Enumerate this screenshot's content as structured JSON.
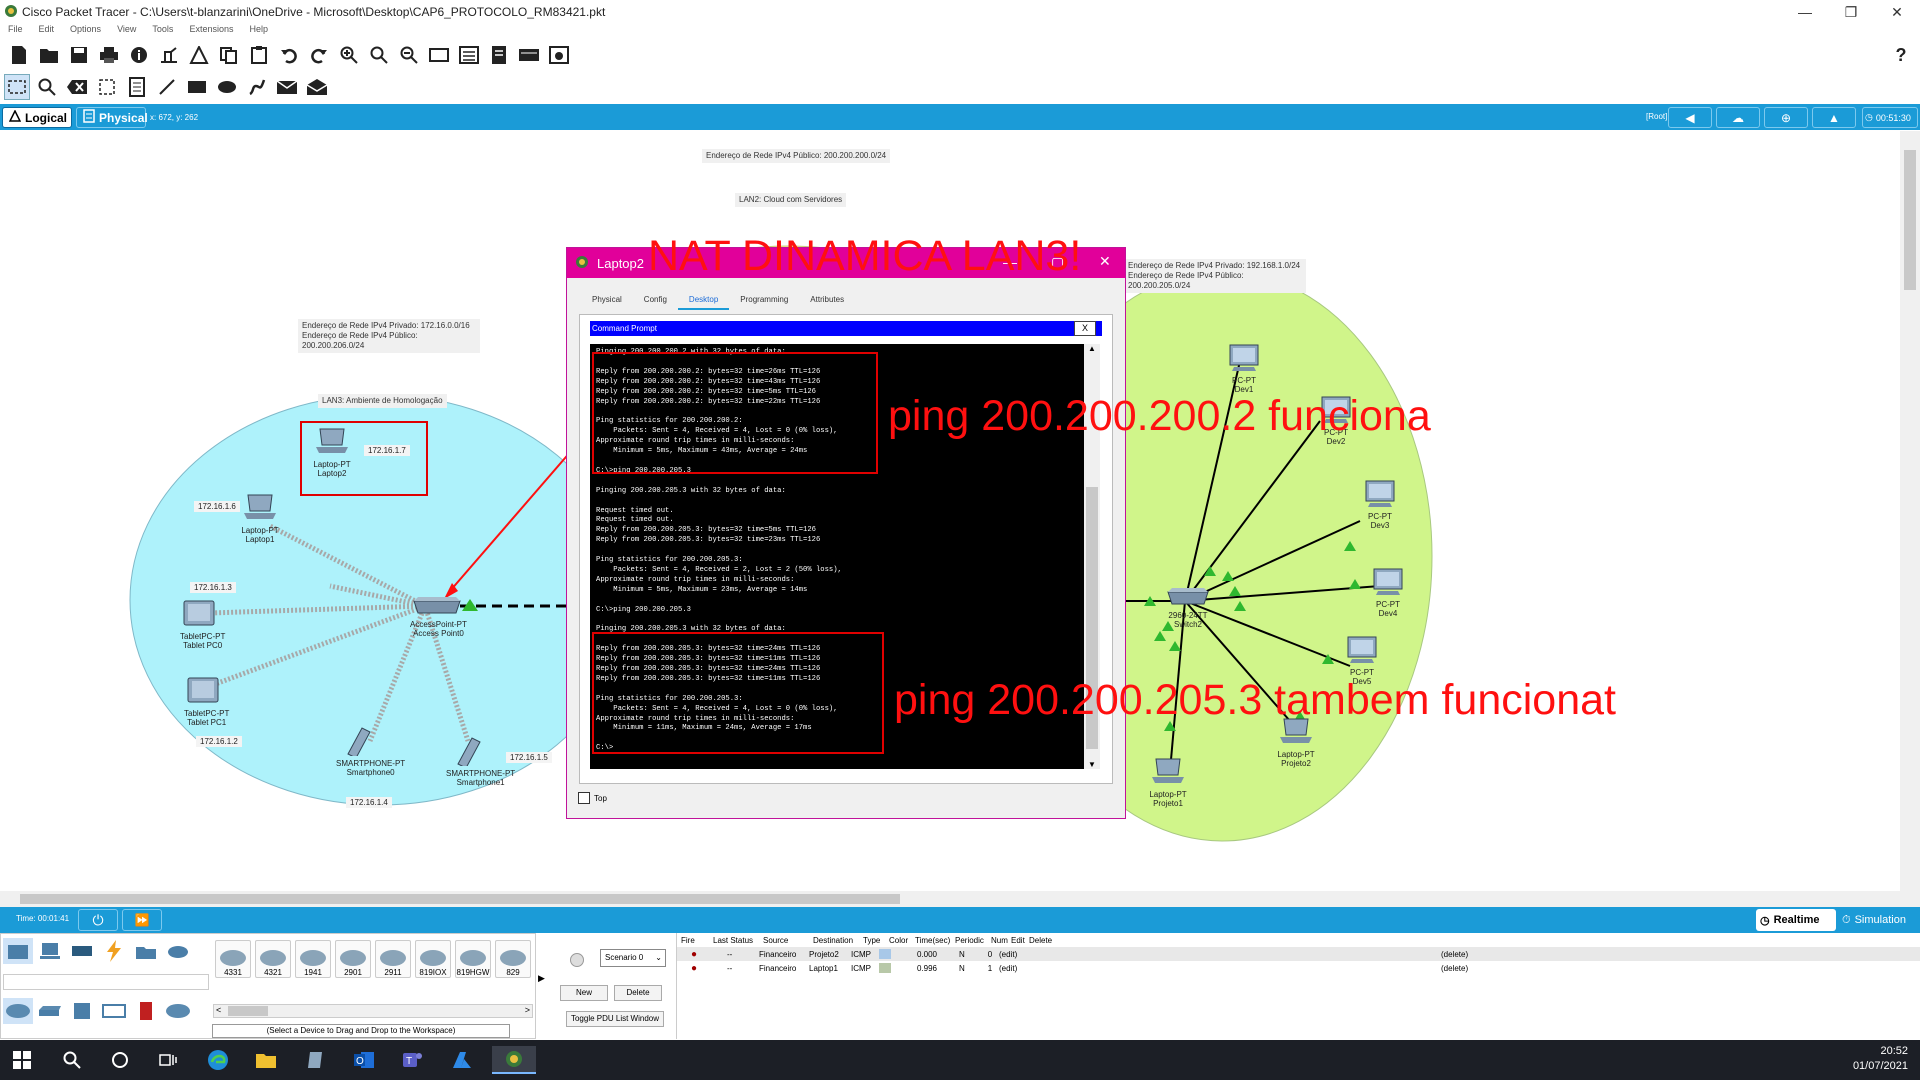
{
  "window": {
    "title": "Cisco Packet Tracer - C:\\Users\\t-blanzarini\\OneDrive - Microsoft\\Desktop\\CAP6_PROTOCOLO_RM83421.pkt",
    "controls": [
      "—",
      "❐",
      "✕"
    ]
  },
  "menu": [
    "File",
    "Edit",
    "Options",
    "View",
    "Tools",
    "Extensions",
    "Help"
  ],
  "modebar": {
    "logical": "Logical",
    "physical": "Physical",
    "coords": "x: 672, y: 262",
    "root": "[Root]",
    "time": "00:51:30"
  },
  "workspace": {
    "notes": {
      "lan2_public": "Endereço de Rede IPv4 Público: 200.200.200.0/24",
      "lan2_title": "LAN2: Cloud com Servidores",
      "lan3_private": "Endereço de Rede IPv4 Privado: 172.16.0.0/16",
      "lan3_public": "Endereço de Rede IPv4 Público: 200.200.206.0/24",
      "lan3_title": "LAN3: Ambiente de Homologação",
      "lan1_private": "Endereço de Rede IPv4 Privado: 192.168.1.0/24",
      "lan1_public": "Endereço de Rede IPv4 Público: 200.200.205.0/24"
    },
    "devices": {
      "laptop2": [
        "Laptop-PT",
        "Laptop2"
      ],
      "laptop2_ip": "172.16.1.7",
      "laptop1": [
        "Laptop-PT",
        "Laptop1"
      ],
      "laptop1_ip": "172.16.1.6",
      "tablet0": [
        "TabletPC-PT",
        "Tablet PC0"
      ],
      "tablet0_ip": "172.16.1.3",
      "tablet1": [
        "TabletPC-PT",
        "Tablet PC1"
      ],
      "tablet1_ip": "172.16.1.2",
      "ap": [
        "AccessPoint-PT",
        "Access Point0"
      ],
      "smart0": [
        "SMARTPHONE-PT",
        "Smartphone0"
      ],
      "smart0_ip": "172.16.1.4",
      "smart1": [
        "SMARTPHONE-PT",
        "Smartphone1"
      ],
      "smart1_ip": "172.16.1.5",
      "dev1": [
        "PC-PT",
        "Dev1"
      ],
      "dev2": [
        "PC-PT",
        "Dev2"
      ],
      "dev3": [
        "PC-PT",
        "Dev3"
      ],
      "dev4": [
        "PC-PT",
        "Dev4"
      ],
      "dev5": [
        "PC-PT",
        "Dev5"
      ],
      "switch2": [
        "2960-24TT",
        "Switch2"
      ],
      "projeto2": [
        "Laptop-PT",
        "Projeto2"
      ],
      "projeto1": [
        "Laptop-PT",
        "Projeto1"
      ]
    }
  },
  "laptop_window": {
    "title": "Laptop2",
    "tabs": [
      "Physical",
      "Config",
      "Desktop",
      "Programming",
      "Attributes"
    ],
    "active_tab": "Desktop",
    "cmd_title": "Command Prompt",
    "cmd_close": "X",
    "top_checkbox": "Top",
    "output": [
      "Pinging 200.200.200.2 with 32 bytes of data:",
      "",
      "Reply from 200.200.200.2: bytes=32 time=26ms TTL=126",
      "Reply from 200.200.200.2: bytes=32 time=43ms TTL=126",
      "Reply from 200.200.200.2: bytes=32 time=5ms TTL=126",
      "Reply from 200.200.200.2: bytes=32 time=22ms TTL=126",
      "",
      "Ping statistics for 200.200.200.2:",
      "    Packets: Sent = 4, Received = 4, Lost = 0 (0% loss),",
      "Approximate round trip times in milli-seconds:",
      "    Minimum = 5ms, Maximum = 43ms, Average = 24ms",
      "",
      "C:\\>ping 200.200.205.3",
      "",
      "Pinging 200.200.205.3 with 32 bytes of data:",
      "",
      "Request timed out.",
      "Request timed out.",
      "Reply from 200.200.205.3: bytes=32 time=5ms TTL=126",
      "Reply from 200.200.205.3: bytes=32 time=23ms TTL=126",
      "",
      "Ping statistics for 200.200.205.3:",
      "    Packets: Sent = 4, Received = 2, Lost = 2 (50% loss),",
      "Approximate round trip times in milli-seconds:",
      "    Minimum = 5ms, Maximum = 23ms, Average = 14ms",
      "",
      "C:\\>ping 200.200.205.3",
      "",
      "Pinging 200.200.205.3 with 32 bytes of data:",
      "",
      "Reply from 200.200.205.3: bytes=32 time=24ms TTL=126",
      "Reply from 200.200.205.3: bytes=32 time=11ms TTL=126",
      "Reply from 200.200.205.3: bytes=32 time=24ms TTL=126",
      "Reply from 200.200.205.3: bytes=32 time=11ms TTL=126",
      "",
      "Ping statistics for 200.200.205.3:",
      "    Packets: Sent = 4, Received = 4, Lost = 0 (0% loss),",
      "Approximate round trip times in milli-seconds:",
      "    Minimum = 11ms, Maximum = 24ms, Average = 17ms",
      "",
      "C:\\>"
    ]
  },
  "annotations": {
    "nat": "NAT DINAMICA LAN3!",
    "ping1": "ping 200.200.200.2 funciona",
    "ping2": "ping 200.200.205.3 tambem funcionat",
    "color": "#ff1010"
  },
  "bottom": {
    "time": "Time: 00:01:41",
    "realtime": "Realtime",
    "simulation": "Simulation",
    "router_models": [
      "4331",
      "4321",
      "1941",
      "2901",
      "2911",
      "819IOX",
      "819HGW",
      "829"
    ],
    "select_hint": "(Select a Device to Drag and Drop to the Workspace)",
    "scenario": "Scenario 0",
    "new_btn": "New",
    "delete_btn": "Delete",
    "toggle_btn": "Toggle PDU List Window",
    "pdu_headers": [
      "Fire",
      "Last Status",
      "Source",
      "Destination",
      "Type",
      "Color",
      "Time(sec)",
      "Periodic",
      "Num",
      "Edit",
      "Delete"
    ],
    "pdu_rows": [
      [
        "●",
        "--",
        "Financeiro",
        "Projeto2",
        "ICMP",
        "",
        "0.000",
        "N",
        "0",
        "(edit)",
        "(delete)"
      ],
      [
        "●",
        "--",
        "Financeiro",
        "Laptop1",
        "ICMP",
        "",
        "0.996",
        "N",
        "1",
        "(edit)",
        "(delete)"
      ]
    ],
    "pdu_colors": [
      "#a8c8e8",
      "#b8c8a8"
    ]
  },
  "taskbar": {
    "time": "20:52",
    "date": "01/07/2021"
  }
}
